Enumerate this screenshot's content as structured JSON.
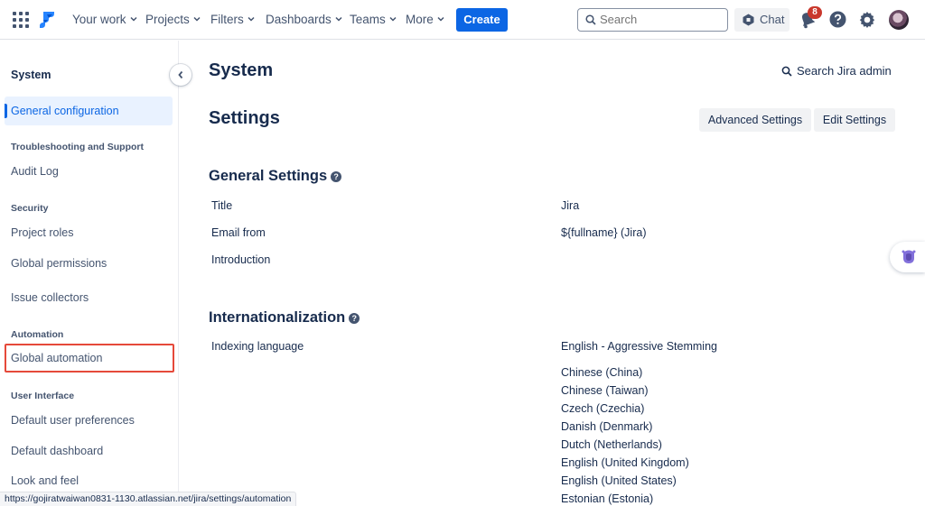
{
  "topnav": {
    "items": [
      {
        "label": "Your work"
      },
      {
        "label": "Projects"
      },
      {
        "label": "Filters"
      },
      {
        "label": "Dashboards"
      },
      {
        "label": "Teams"
      },
      {
        "label": "More"
      }
    ],
    "create_label": "Create",
    "search_placeholder": "Search",
    "chat_label": "Chat",
    "notification_count": "8"
  },
  "sidebar": {
    "title": "System",
    "active_item": "General configuration",
    "sections": {
      "troubleshooting": "Troubleshooting and Support",
      "security": "Security",
      "automation": "Automation",
      "user_interface": "User Interface"
    },
    "items": {
      "audit_log": "Audit Log",
      "project_roles": "Project roles",
      "global_permissions": "Global permissions",
      "issue_collectors": "Issue collectors",
      "global_automation": "Global automation",
      "default_user_preferences": "Default user preferences",
      "default_dashboard": "Default dashboard",
      "look_and_feel": "Look and feel"
    }
  },
  "main": {
    "page_title": "System",
    "search_admin": "Search Jira admin",
    "settings_title": "Settings",
    "advanced_settings": "Advanced Settings",
    "edit_settings": "Edit Settings",
    "general": {
      "heading": "General Settings",
      "rows": [
        {
          "label": "Title",
          "value": "Jira"
        },
        {
          "label": "Email from",
          "value": "${fullname} (Jira)"
        },
        {
          "label": "Introduction",
          "value": ""
        }
      ]
    },
    "i18n": {
      "heading": "Internationalization",
      "indexing_label": "Indexing language",
      "indexing_value": "English - Aggressive Stemming",
      "languages": [
        "Chinese (China)",
        "Chinese (Taiwan)",
        "Czech (Czechia)",
        "Danish (Denmark)",
        "Dutch (Netherlands)",
        "English (United Kingdom)",
        "English (United States)",
        "Estonian (Estonia)"
      ]
    }
  },
  "status_url": "https://gojiratwaiwan0831-1130.atlassian.net/jira/settings/automation",
  "colors": {
    "brand": "#0C66E4",
    "highlight_border": "#E5493A",
    "badge": "#C9372C"
  }
}
